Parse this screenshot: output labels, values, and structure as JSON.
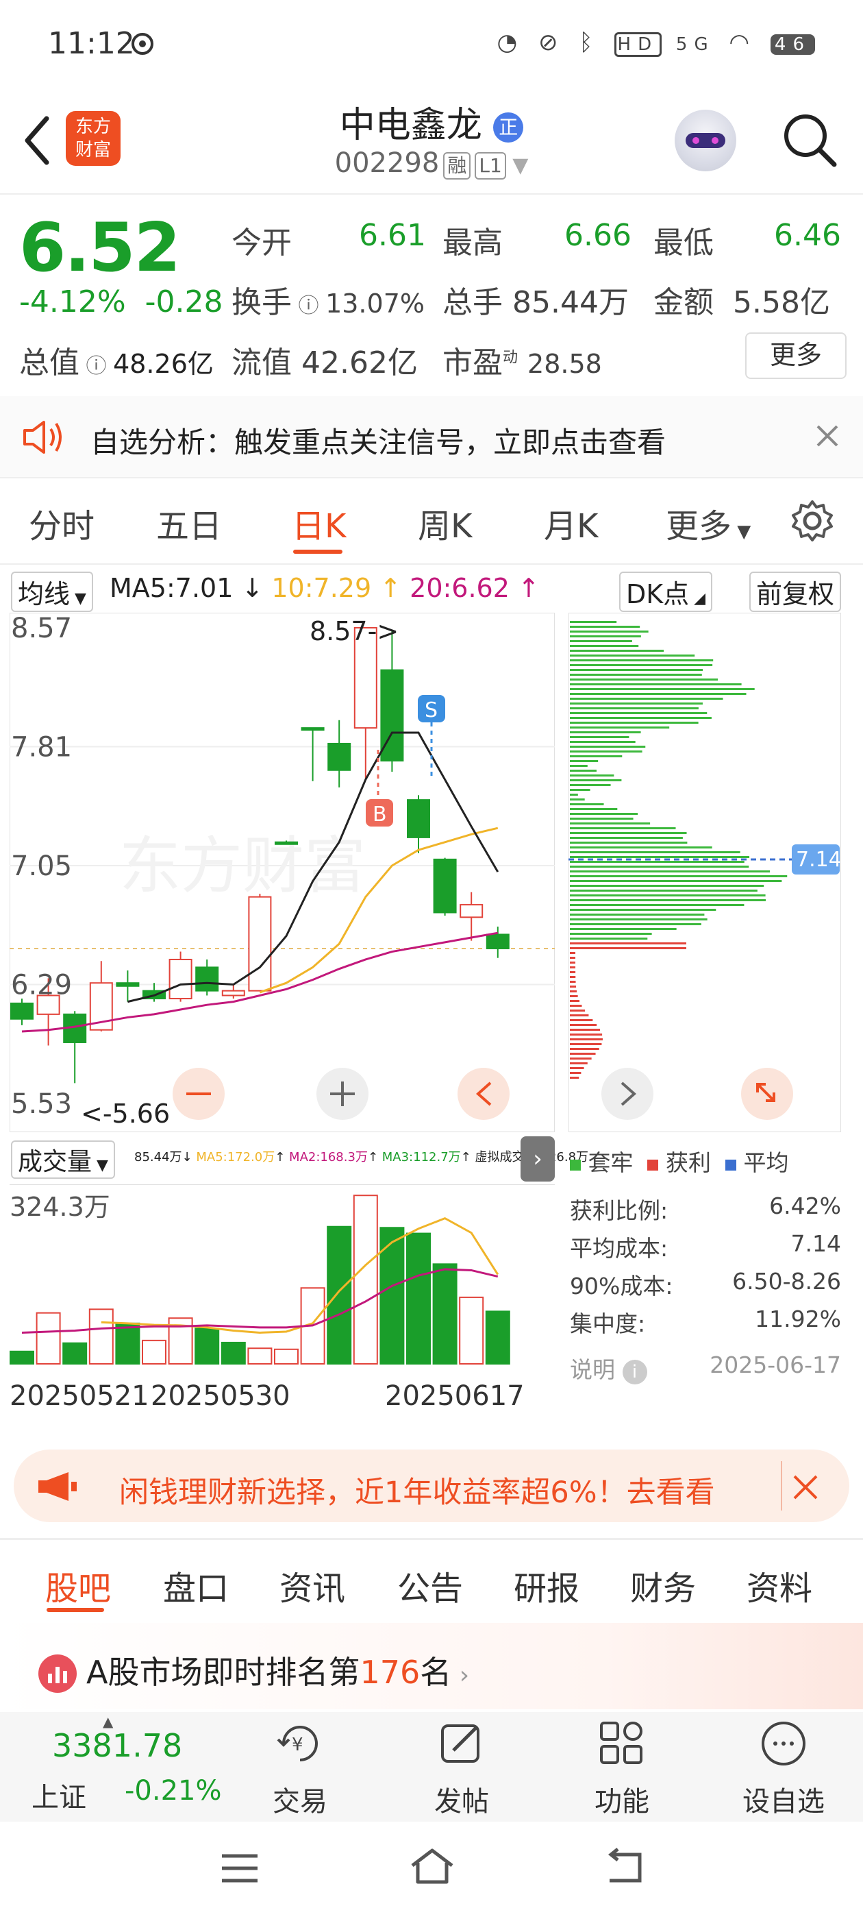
{
  "status_bar": {
    "time": "11:12",
    "icons": [
      "alarm-icon",
      "mute-icon",
      "bluetooth-icon",
      "hd-icon",
      "5g-icon",
      "wifi-icon",
      "battery-icon"
    ],
    "battery": "46"
  },
  "header": {
    "logo_line1": "东方",
    "logo_line2": "财富",
    "title": "中电鑫龙",
    "title_badge": "正",
    "code": "002298",
    "tag1": "融",
    "tag2": "L1"
  },
  "quote": {
    "price": "6.52",
    "change_pct": "-4.12%",
    "change": "-0.28",
    "open_label": "今开",
    "open": "6.61",
    "high_label": "最高",
    "high": "6.66",
    "low_label": "最低",
    "low": "6.46",
    "turnover_label": "换手",
    "turnover": "13.07%",
    "volume_label": "总手",
    "volume": "85.44万",
    "amount_label": "金额",
    "amount": "5.58亿",
    "mktcap_label": "总值",
    "mktcap": "48.26亿",
    "float_label": "流值",
    "float": "42.62亿",
    "pe_label": "市盈",
    "pe_sup": "动",
    "pe": "28.58",
    "more_label": "更多"
  },
  "notice": {
    "text": "自选分析：触发重点关注信号，立即点击查看"
  },
  "tabs": [
    "分时",
    "五日",
    "日K",
    "周K",
    "月K",
    "更多"
  ],
  "toolbar": {
    "ma_select": "均线",
    "ma5": "MA5:7.01",
    "ma10": "10:7.29",
    "ma20": "20:6.62",
    "dk": "DK点",
    "adjust": "前复权"
  },
  "chart": {
    "price_labels": [
      "8.57",
      "7.81",
      "7.05",
      "6.29",
      "5.53"
    ],
    "max_note": "8.57->",
    "min_note": "<-5.66",
    "buy_tag": "B",
    "sell_tag": "S",
    "watermark": "东方财富",
    "cost_marker": "7.14",
    "volume_select": "成交量",
    "volume_legend": [
      "85.44万",
      "MA5:172.0万",
      "MA2:168.3万",
      "MA3:112.7万",
      "虚拟成交量:126.8万"
    ],
    "volume_max": "324.3万",
    "dates": [
      "20250521",
      "20250530",
      "20250617"
    ]
  },
  "chart_data": {
    "type": "candlestick",
    "ylim": [
      5.53,
      8.57
    ],
    "candles": [
      {
        "o": 6.17,
        "c": 6.07,
        "h": 6.2,
        "l": 6.03
      },
      {
        "o": 6.1,
        "c": 6.22,
        "h": 6.33,
        "l": 5.9
      },
      {
        "o": 6.1,
        "c": 5.92,
        "h": 6.12,
        "l": 5.66
      },
      {
        "o": 6.0,
        "c": 6.3,
        "h": 6.44,
        "l": 5.99
      },
      {
        "o": 6.3,
        "c": 6.28,
        "h": 6.38,
        "l": 6.18
      },
      {
        "o": 6.25,
        "c": 6.2,
        "h": 6.3,
        "l": 6.18
      },
      {
        "o": 6.2,
        "c": 6.45,
        "h": 6.5,
        "l": 6.18
      },
      {
        "o": 6.4,
        "c": 6.25,
        "h": 6.45,
        "l": 6.22
      },
      {
        "o": 6.22,
        "c": 6.25,
        "h": 6.29,
        "l": 6.2
      },
      {
        "o": 6.25,
        "c": 6.85,
        "h": 6.87,
        "l": 6.25
      },
      {
        "o": 7.2,
        "c": 7.2,
        "h": 7.21,
        "l": 7.19
      },
      {
        "o": 7.93,
        "c": 7.93,
        "h": 7.93,
        "l": 7.59
      },
      {
        "o": 7.83,
        "c": 7.66,
        "h": 7.98,
        "l": 7.55
      },
      {
        "o": 7.93,
        "c": 8.57,
        "h": 8.57,
        "l": 7.6
      },
      {
        "o": 8.3,
        "c": 7.72,
        "h": 8.55,
        "l": 7.65
      },
      {
        "o": 7.47,
        "c": 7.23,
        "h": 7.5,
        "l": 7.13
      },
      {
        "o": 7.09,
        "c": 6.75,
        "h": 7.1,
        "l": 6.73
      },
      {
        "o": 6.72,
        "c": 6.8,
        "h": 6.88,
        "l": 6.57
      },
      {
        "o": 6.61,
        "c": 6.52,
        "h": 6.66,
        "l": 6.46
      }
    ],
    "ma5": [
      null,
      null,
      null,
      null,
      6.18,
      6.22,
      6.29,
      6.3,
      6.29,
      6.4,
      6.6,
      6.95,
      7.2,
      7.6,
      7.9,
      7.9,
      7.6,
      7.3,
      7.01
    ],
    "ma10": [
      null,
      null,
      null,
      null,
      null,
      null,
      null,
      null,
      null,
      6.24,
      6.3,
      6.4,
      6.55,
      6.85,
      7.05,
      7.15,
      7.2,
      7.25,
      7.29
    ],
    "ma20": [
      5.99,
      6.0,
      6.02,
      6.05,
      6.08,
      6.1,
      6.13,
      6.16,
      6.18,
      6.22,
      6.26,
      6.32,
      6.39,
      6.45,
      6.5,
      6.53,
      6.56,
      6.59,
      6.62
    ],
    "volume_max": 324.3,
    "volume": [
      24,
      98,
      40,
      105,
      78,
      45,
      88,
      68,
      41,
      30,
      28,
      146,
      264,
      324,
      262,
      251,
      192,
      128,
      101
    ],
    "volume_up": [
      false,
      true,
      false,
      true,
      false,
      true,
      true,
      false,
      false,
      true,
      true,
      true,
      false,
      true,
      false,
      false,
      false,
      true,
      false
    ],
    "vol_ma5": [
      null,
      null,
      null,
      80,
      78,
      75,
      74,
      70,
      64,
      60,
      62,
      78,
      140,
      190,
      234,
      260,
      280,
      252,
      172
    ],
    "vol_ma10": [
      60,
      62,
      64,
      68,
      70,
      72,
      72,
      74,
      72,
      70,
      70,
      74,
      95,
      120,
      150,
      170,
      182,
      180,
      168
    ]
  },
  "chip_panel": {
    "legend": [
      "套牢",
      "获利",
      "平均"
    ],
    "profit_ratio_label": "获利比例:",
    "profit_ratio": "6.42%",
    "avg_cost_label": "平均成本:",
    "avg_cost": "7.14",
    "cost90_label": "90%成本:",
    "cost90": "6.50-8.26",
    "concentration_label": "集中度:",
    "concentration": "11.92%",
    "note_label": "说明",
    "date": "2025-06-17"
  },
  "banner": {
    "text": "闲钱理财新选择，近1年收益率超6%！去看看"
  },
  "bottom_tabs": [
    "股吧",
    "盘口",
    "资讯",
    "公告",
    "研报",
    "财务",
    "资料"
  ],
  "rank": {
    "prefix": "A股市场即时排名第",
    "number": "176",
    "suffix": "名"
  },
  "bottom_nav": {
    "index_value": "3381.78",
    "index_name": "上证",
    "index_change": "-0.21%",
    "items": [
      "交易",
      "发帖",
      "功能",
      "设自选"
    ]
  },
  "colors": {
    "brand": "#ee4e22",
    "down": "#1a9e2a",
    "up": "#e2433a",
    "ma5": "#222222",
    "ma10": "#f0b429",
    "ma20": "#c2187b"
  }
}
